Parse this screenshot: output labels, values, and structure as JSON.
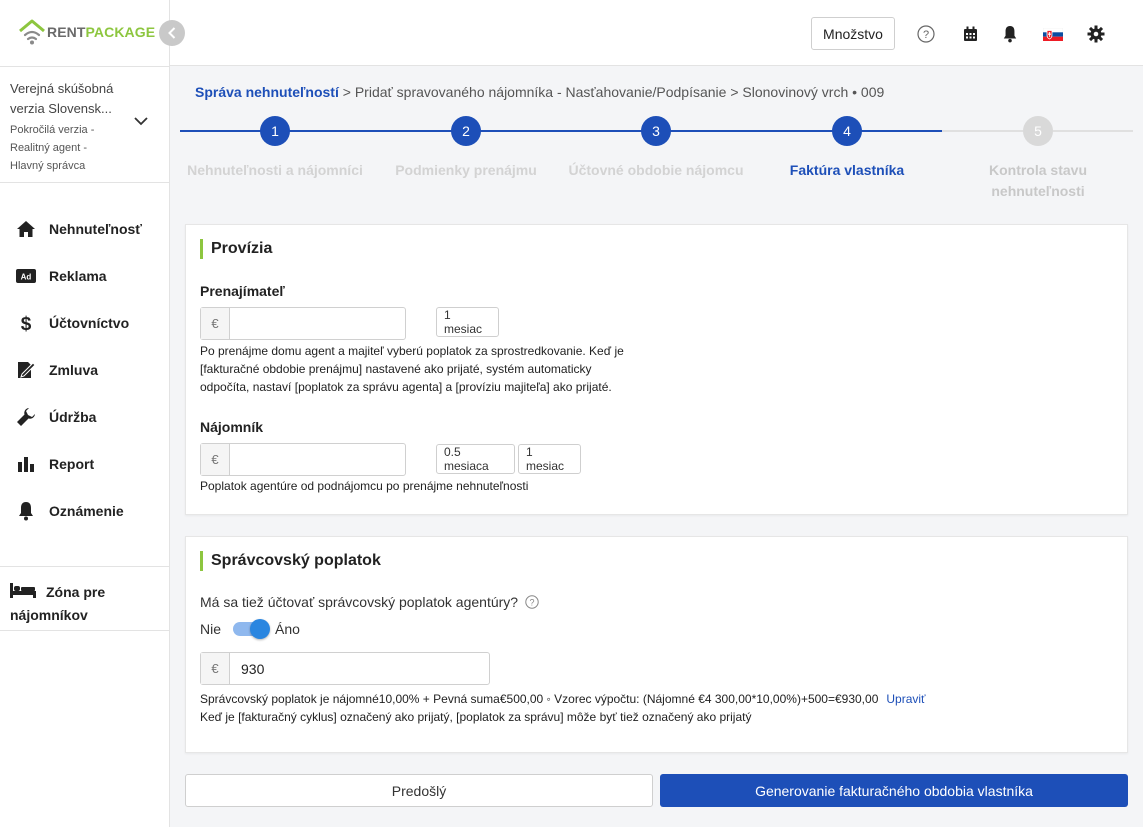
{
  "brand": {
    "name_part1": "RENT",
    "name_part2": "PACKAGE",
    "accent": "#8dc63f",
    "primary": "#1d4fb8"
  },
  "account": {
    "name": "Verejná skúšobná verzia Slovensk...",
    "role": "Pokročilá verzia - Realitný agent - Hlavný správca"
  },
  "nav": [
    {
      "label": "Nehnuteľnosť",
      "icon": "home-icon"
    },
    {
      "label": "Reklama",
      "icon": "ad-icon"
    },
    {
      "label": "Účtovníctvo",
      "icon": "dollar-icon"
    },
    {
      "label": "Zmluva",
      "icon": "contract-icon"
    },
    {
      "label": "Údržba",
      "icon": "wrench-icon"
    },
    {
      "label": "Report",
      "icon": "bar-chart-icon"
    },
    {
      "label": "Oznámenie",
      "icon": "bell-icon"
    }
  ],
  "tenant_zone": {
    "label": "Zóna pre nájomníkov",
    "icon": "bed-icon"
  },
  "topbar": {
    "quantity_label": "Množstvo",
    "icons": [
      "help-icon",
      "calendar-icon",
      "bell-icon",
      "slovak-flag-icon",
      "gear-icon"
    ]
  },
  "breadcrumb": {
    "first": "Správa nehnuteľností",
    "rest": " > Pridať spravovaného nájomníka - Nasťahovanie/Podpísanie > Slonovinový vrch • 009"
  },
  "steps": [
    {
      "number": "1",
      "label": "Nehnuteľnosti a nájomníci",
      "state": "done"
    },
    {
      "number": "2",
      "label": "Podmienky prenájmu",
      "state": "done"
    },
    {
      "number": "3",
      "label": "Účtovné obdobie nájomcu",
      "state": "done"
    },
    {
      "number": "4",
      "label": "Faktúra vlastníka",
      "state": "active"
    },
    {
      "number": "5",
      "label": "Kontrola stavu nehnuteľnosti",
      "state": "todo"
    }
  ],
  "commission": {
    "title": "Provízia",
    "landlord": {
      "label": "Prenajímateľ",
      "currency": "€",
      "value": "",
      "chips": [
        "1 mesiac"
      ],
      "help": "Po prenájme domu agent a majiteľ vyberú poplatok za sprostredkovanie. Keď je [fakturačné obdobie prenájmu] nastavené ako prijaté, systém automaticky odpočíta, nastaví [poplatok za správu agenta] a [províziu majiteľa] ako prijaté."
    },
    "tenant": {
      "label": "Nájomník",
      "currency": "€",
      "value": "",
      "chips": [
        "0.5 mesiaca",
        "1 mesiac"
      ],
      "help": "Poplatok agentúre od podnájomcu po prenájme nehnuteľnosti"
    }
  },
  "management_fee": {
    "title": "Správcovský poplatok",
    "question": "Má sa tiež účtovať správcovský poplatok agentúry?",
    "toggle_off": "Nie",
    "toggle_on": "Áno",
    "toggle_state": true,
    "currency": "€",
    "value": "930",
    "formula": "Správcovský poplatok je nájomné10,00% + Pevná suma€500,00 ◦ Vzorec výpočtu: (Nájomné €4 300,00*10,00%)+500=€930,00",
    "edit_label": "Upraviť",
    "note": "Keď je [fakturačný cyklus] označený ako prijatý, [poplatok za správu] môže byť tiež označený ako prijatý"
  },
  "footer": {
    "prev_label": "Predošlý",
    "generate_label": "Generovanie fakturačného obdobia vlastníka"
  }
}
